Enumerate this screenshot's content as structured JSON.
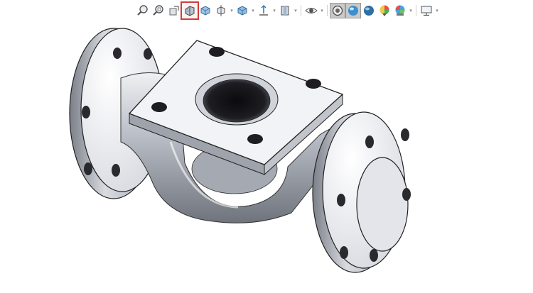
{
  "toolbar": {
    "items": [
      {
        "icon": "zoom-to-fit-icon"
      },
      {
        "icon": "zoom-to-area-icon"
      },
      {
        "icon": "previous-view-icon"
      },
      {
        "icon": "section-view-icon",
        "selected": true
      },
      {
        "icon": "dynamic-annotation-view-icon"
      },
      {
        "icon": "view-orientation-icon",
        "has_menu": true
      },
      {
        "icon": "display-style-icon",
        "has_menu": true
      },
      {
        "icon": "hide-show-items-icon",
        "has_menu": true
      },
      {
        "icon": "edit-appearance-icon",
        "has_menu": true
      },
      {
        "icon": "apply-scene-icon",
        "has_menu": true
      },
      {
        "icon": "view-settings-icon",
        "pressed": true
      },
      {
        "icon": "realview-graphics-icon",
        "pressed": true
      },
      {
        "icon": "shadows-icon"
      },
      {
        "icon": "appearance-icon"
      },
      {
        "icon": "scene-icon",
        "has_menu": true
      },
      {
        "icon": "monitor-display-icon",
        "has_menu": true
      }
    ],
    "highlight_color": "#d23a3a"
  },
  "model": {
    "icon": "valve-body-3d-model",
    "color": "#c8cbd3"
  }
}
